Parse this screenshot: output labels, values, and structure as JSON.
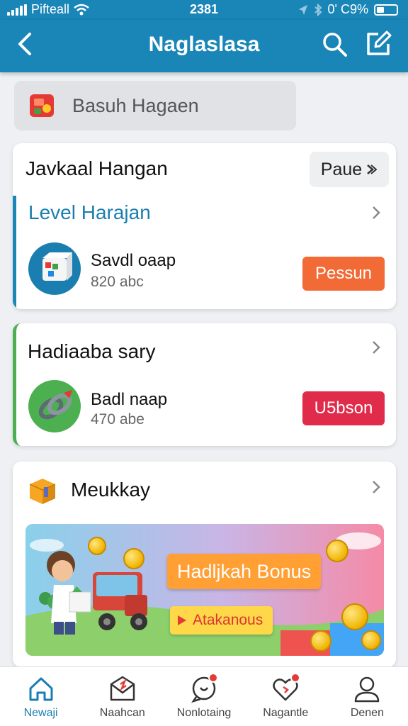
{
  "status_bar": {
    "carrier": "Pifteall",
    "time": "2381",
    "battery": "0' C9%"
  },
  "header": {
    "title": "Naglaslasa"
  },
  "search": {
    "placeholder": "Basuh Hagaen"
  },
  "card1": {
    "title": "Javkaal Hangan",
    "pill_label": "Paue",
    "section_title": "Level Harajan",
    "item": {
      "name": "Savdl oaap",
      "sub": "820 abc",
      "button_label": "Pessun"
    }
  },
  "card2": {
    "title": "Hadiaaba sary",
    "item": {
      "name": "Badl naap",
      "sub": "470 abe",
      "button_label": "U5bson"
    }
  },
  "card3": {
    "title": "Meukkay",
    "banner": {
      "title": "Hadljkah Bonus",
      "cta": "Atakanous"
    }
  },
  "tabs": [
    {
      "label": "Newaji",
      "icon": "home-icon",
      "active": true
    },
    {
      "label": "Naahcan",
      "icon": "mail-icon",
      "active": false
    },
    {
      "label": "Nonlotaing",
      "icon": "chat-icon",
      "active": false
    },
    {
      "label": "Nagantle",
      "icon": "heart-icon",
      "active": false
    },
    {
      "label": "Denen",
      "icon": "profile-icon",
      "active": false
    }
  ],
  "colors": {
    "primary": "#1a86b8",
    "orange_button": "#f26a35",
    "red_button": "#e02b4a",
    "green_accent": "#4caf50",
    "badge": "#e53935"
  }
}
